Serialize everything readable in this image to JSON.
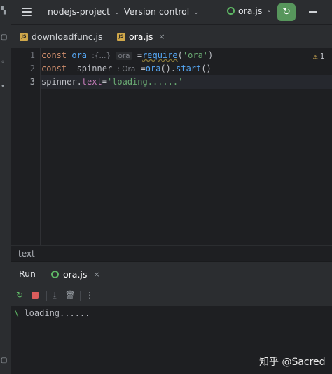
{
  "titlebar": {
    "project": "nodejs-project",
    "version_control": "Version control",
    "run_config": "ora.js"
  },
  "tabs": [
    {
      "badge": "JS",
      "label": "downloadfunc.js",
      "active": false
    },
    {
      "badge": "JS",
      "label": "ora.js",
      "active": true,
      "close": "×"
    }
  ],
  "editor": {
    "lines": [
      {
        "num": "1",
        "t1": "const ",
        "t2": "ora",
        "hint": ":{...}",
        "hint2": "ora",
        "t3": " =",
        "fn": "require",
        "t4": "(",
        "str": "'ora'",
        "t5": ")"
      },
      {
        "num": "2",
        "t1": "const  ",
        "t2": "spinner",
        "hint": ": Ora",
        "t3": " =",
        "fn": "ora",
        "t4": "().",
        "fn2": "start",
        "t5": "()"
      },
      {
        "num": "3",
        "t1": "spinner.",
        "t2": "text",
        "t3": "=",
        "str": "'loading......'"
      }
    ],
    "warnings": "1"
  },
  "breadcrumb": "text",
  "run": {
    "title": "Run",
    "tab_label": "ora.js",
    "tab_close": "×",
    "console": {
      "spinner": "\\",
      "text": " loading......"
    }
  },
  "watermark": "知乎 @Sacred",
  "colors": {
    "accent": "#3574f0",
    "run_green": "#57965c",
    "stop_red": "#db5c5c"
  }
}
